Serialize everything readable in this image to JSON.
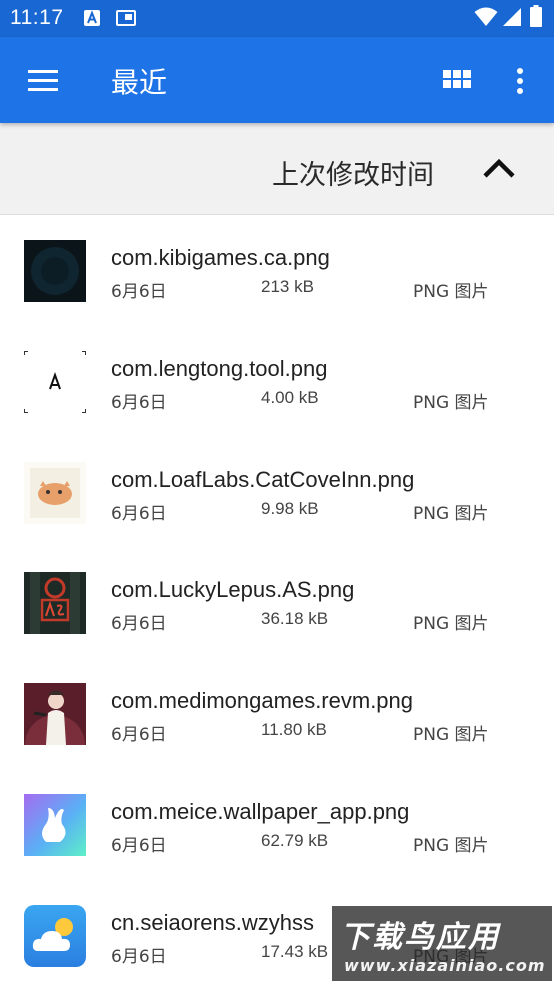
{
  "status_bar": {
    "time": "11:17",
    "icons": [
      "a-notification-icon",
      "screenshot-icon",
      "wifi-icon",
      "signal-icon",
      "battery-icon"
    ]
  },
  "app_bar": {
    "title": "最近",
    "icons": [
      "menu-icon",
      "grid-view-icon",
      "more-vert-icon"
    ]
  },
  "sort": {
    "label": "上次修改时间",
    "direction_icon": "chevron-up-icon"
  },
  "files": [
    {
      "name": "com.kibigames.ca.png",
      "date": "6月6日",
      "size": "213 kB",
      "type": "PNG 图片"
    },
    {
      "name": "com.lengtong.tool.png",
      "date": "6月6日",
      "size": "4.00 kB",
      "type": "PNG 图片"
    },
    {
      "name": "com.LoafLabs.CatCoveInn.png",
      "date": "6月6日",
      "size": "9.98 kB",
      "type": "PNG 图片"
    },
    {
      "name": "com.LuckyLepus.AS.png",
      "date": "6月6日",
      "size": "36.18 kB",
      "type": "PNG 图片"
    },
    {
      "name": "com.medimongames.revm.png",
      "date": "6月6日",
      "size": "11.80 kB",
      "type": "PNG 图片"
    },
    {
      "name": "com.meice.wallpaper_app.png",
      "date": "6月6日",
      "size": "62.79 kB",
      "type": "PNG 图片"
    },
    {
      "name": "cn.seiaorens.wzyhss",
      "date": "6月6日",
      "size": "17.43 kB",
      "type": "PNG 图片"
    }
  ],
  "watermark": {
    "title": "下载鸟应用",
    "url": "www.xiazainiao.com"
  },
  "colors": {
    "status_bar": "#1967d2",
    "app_bar": "#1e73e6",
    "sort_bar": "#f1f1f1"
  }
}
